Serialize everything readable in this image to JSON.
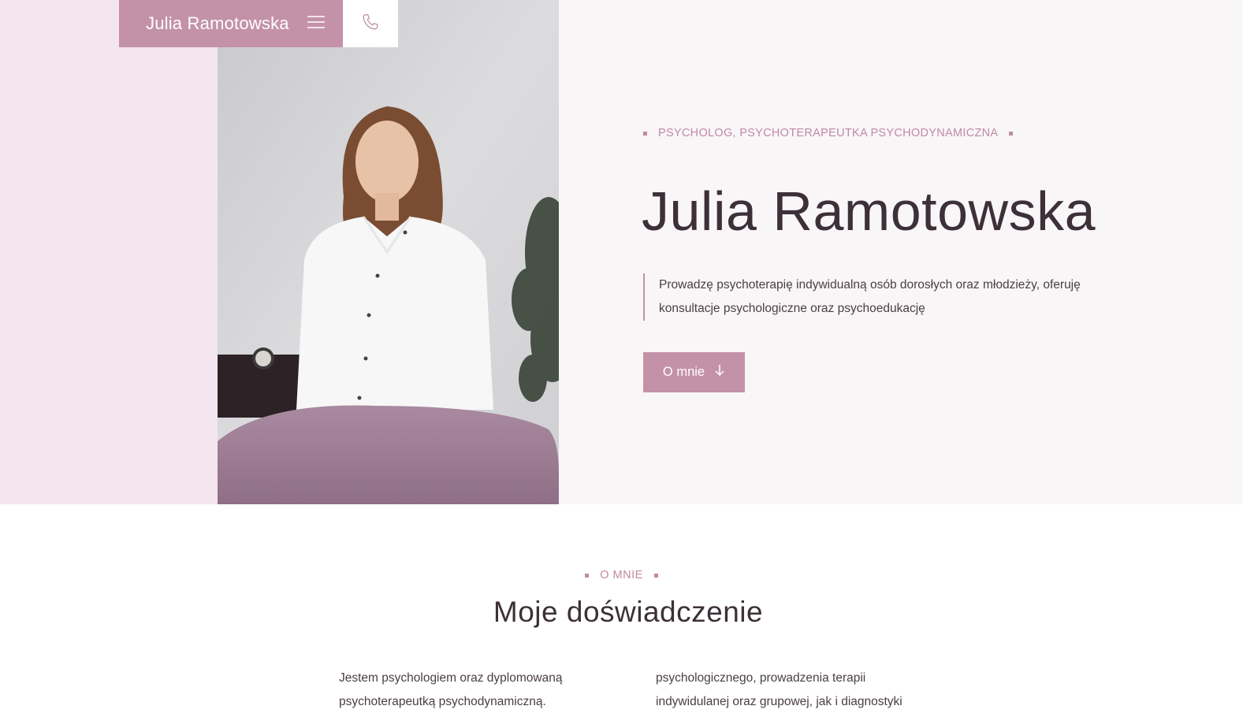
{
  "navbar": {
    "brand_name": "Julia Ramotowska",
    "menu_icon": "hamburger-menu-icon",
    "phone_icon": "phone-icon"
  },
  "hero": {
    "eyebrow": "PSYCHOLOG, PSYCHOTERAPEUTKA PSYCHODYNAMICZNA",
    "title": "Julia Ramotowska",
    "description": "Prowadzę psychoterapię indywidualną osób dorosłych oraz młodzieży, oferuję konsultacje psychologiczne oraz psychoedukację",
    "cta_label": "O mnie",
    "cta_icon": "arrow-down-icon"
  },
  "about": {
    "eyebrow": "O MNIE",
    "title": "Moje doświadczenie",
    "col1_line1": "Jestem psychologiem oraz dyplomowaną",
    "col1_line2": "psychoterapeutką psychodynamiczną.",
    "col2_line1": "psychologicznego, prowadzenia terapii",
    "col2_line2": "indywidulanej oraz grupowej, jak i diagnostyki"
  },
  "colors": {
    "accent": "#c492a8",
    "accent_text": "#c08aa2",
    "hero_bg": "#f9f6f8",
    "left_band": "#f3e6ee",
    "text_dark": "#3d3038"
  }
}
